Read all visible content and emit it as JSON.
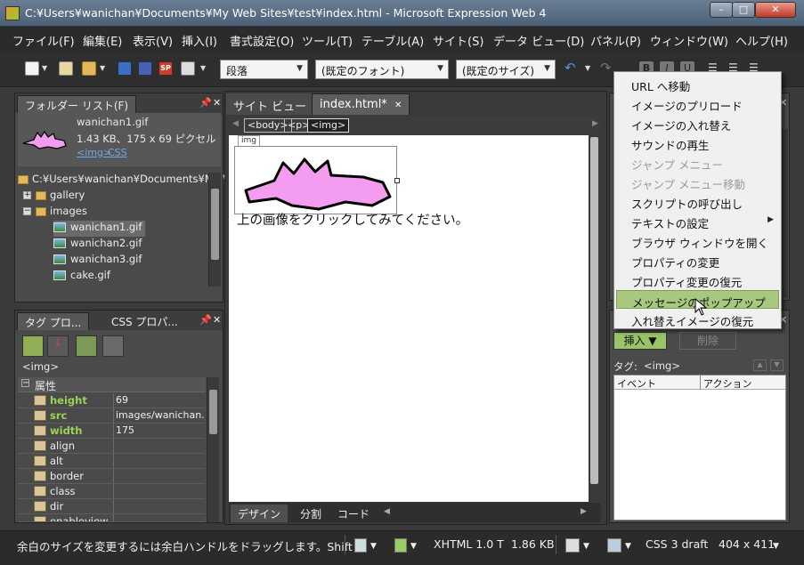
{
  "window": {
    "title": "C:¥Users¥wanichan¥Documents¥My Web Sites¥test¥index.html - Microsoft Expression Web 4",
    "min": "–",
    "max": "□",
    "close": "✕"
  },
  "menu": [
    "ファイル(F)",
    "編集(E)",
    "表示(V)",
    "挿入(I)",
    "書式設定(O)",
    "ツール(T)",
    "テーブル(A)",
    "サイト(S)",
    "データ ビュー(D)",
    "パネル(P)",
    "ウィンドウ(W)",
    "ヘルプ(H)"
  ],
  "toolbar": {
    "style_combo": "段落",
    "font_combo": "(既定のフォント)",
    "size_combo": "(既定のサイズ)",
    "bold": "B",
    "italic": "I",
    "underline": "U"
  },
  "folder_panel": {
    "tab": "フォルダー リスト(F)",
    "file_name": "wanichan1.gif",
    "file_info": "1.43 KB、175 x 69 ピクセル",
    "tag_link": "<img>",
    "css_link": "CSS",
    "root_path": "C:¥Users¥wanichan¥Documents¥My W",
    "tree": [
      "gallery",
      "images",
      "wanichan1.gif",
      "wanichan2.gif",
      "wanichan3.gif",
      "cake.gif"
    ]
  },
  "tag_panel": {
    "tab_tag": "タグ プロ...",
    "tab_css": "CSS プロパ...",
    "current_tag": "<img>",
    "group": "属性",
    "props": [
      {
        "name": "height",
        "value": "69",
        "bold": true
      },
      {
        "name": "src",
        "value": "images/wanichan...",
        "bold": true
      },
      {
        "name": "width",
        "value": "175",
        "bold": true
      },
      {
        "name": "align",
        "value": "",
        "bold": false
      },
      {
        "name": "alt",
        "value": "",
        "bold": false
      },
      {
        "name": "border",
        "value": "",
        "bold": false
      },
      {
        "name": "class",
        "value": "",
        "bold": false
      },
      {
        "name": "dir",
        "value": "",
        "bold": false
      },
      {
        "name": "enableview",
        "value": "",
        "bold": false
      }
    ]
  },
  "editor": {
    "tab_site": "サイト ビュー",
    "tab_doc": "index.html*",
    "breadcrumb": [
      "<body>",
      "<p>",
      "<img>"
    ],
    "img_label": "img",
    "body_text": "上の画像をクリックしてみてください。",
    "view_tabs": [
      "デザイン",
      "分割",
      "コード"
    ]
  },
  "behaviors": {
    "insert_button": "挿入 ▼",
    "delete_button": "削除",
    "tag_label": "タグ:",
    "tag_value": "<img>",
    "col_event": "イベント",
    "col_action": "アクション",
    "menu_items": [
      {
        "label": "URL へ移動",
        "disabled": false,
        "submenu": false,
        "highlight": false
      },
      {
        "label": "イメージのプリロード",
        "disabled": false,
        "submenu": false,
        "highlight": false
      },
      {
        "label": "イメージの入れ替え",
        "disabled": false,
        "submenu": false,
        "highlight": false
      },
      {
        "label": "サウンドの再生",
        "disabled": false,
        "submenu": false,
        "highlight": false
      },
      {
        "label": "ジャンプ メニュー",
        "disabled": true,
        "submenu": false,
        "highlight": false
      },
      {
        "label": "ジャンプ メニュー移動",
        "disabled": true,
        "submenu": false,
        "highlight": false
      },
      {
        "label": "スクリプトの呼び出し",
        "disabled": false,
        "submenu": false,
        "highlight": false
      },
      {
        "label": "テキストの設定",
        "disabled": false,
        "submenu": true,
        "highlight": false
      },
      {
        "label": "ブラウザ ウィンドウを開く",
        "disabled": false,
        "submenu": false,
        "highlight": false
      },
      {
        "label": "プロパティの変更",
        "disabled": false,
        "submenu": false,
        "highlight": false
      },
      {
        "label": "プロパティ変更の復元",
        "disabled": false,
        "submenu": false,
        "highlight": false
      },
      {
        "label": "メッセージのポップアップ",
        "disabled": false,
        "submenu": false,
        "highlight": true
      },
      {
        "label": "入れ替えイメージの復元",
        "disabled": false,
        "submenu": false,
        "highlight": false
      }
    ]
  },
  "status": {
    "message": "余白のサイズを変更するには余白ハンドルをドラッグします。Shift",
    "doctype": "XHTML 1.0 T",
    "size": "1.86 KB",
    "css": "CSS 3 draft",
    "dims": "404 x 411"
  },
  "colors": {
    "highlight": "#a8c880",
    "croc_fill": "#f49cf0",
    "accent_green": "#9bd35a"
  }
}
